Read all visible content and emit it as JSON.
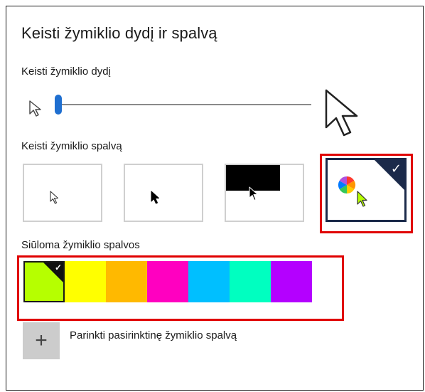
{
  "panel": {
    "title": "Keisti žymiklio dydį ir spalvą"
  },
  "size": {
    "label": "Keisti žymiklio dydį",
    "slider_value_fraction": 0.0
  },
  "color": {
    "label": "Keisti žymiklio spalvą",
    "options": [
      {
        "name": "white",
        "selected": false
      },
      {
        "name": "black",
        "selected": false
      },
      {
        "name": "inverted",
        "selected": false
      },
      {
        "name": "custom",
        "selected": true
      }
    ],
    "check_glyph": "✓"
  },
  "suggested": {
    "label": "Siūloma žymiklio spalvos",
    "colors": [
      "#b6ff00",
      "#ffff00",
      "#ffb900",
      "#ff00c0",
      "#00bfff",
      "#00ffc0",
      "#b400ff"
    ],
    "selected_index": 0,
    "check_glyph": "✓"
  },
  "custom": {
    "plus_glyph": "+",
    "label": "Parinkti pasirinktinę žymiklio spalvą"
  },
  "colors": {
    "accent": "#1f6fd0",
    "selected_border": "#1b2a4a",
    "highlight": "#e00000"
  }
}
